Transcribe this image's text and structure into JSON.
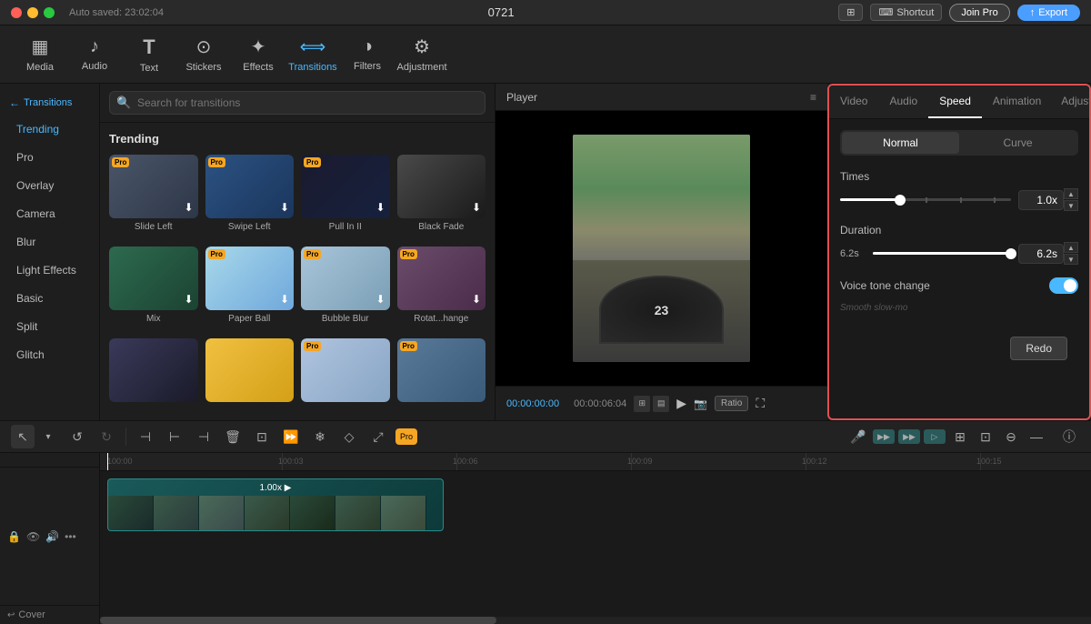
{
  "app": {
    "title": "0721",
    "auto_saved": "Auto saved: 23:02:04"
  },
  "topbar": {
    "shortcut_label": "Shortcut",
    "join_pro_label": "Join Pro",
    "export_label": "Export",
    "display_icon": "⊞"
  },
  "toolbar": {
    "items": [
      {
        "id": "media",
        "label": "Media",
        "icon": "▦"
      },
      {
        "id": "audio",
        "label": "Audio",
        "icon": "♪"
      },
      {
        "id": "text",
        "label": "Text",
        "icon": "T"
      },
      {
        "id": "stickers",
        "label": "Stickers",
        "icon": "⊙"
      },
      {
        "id": "effects",
        "label": "Effects",
        "icon": "✦"
      },
      {
        "id": "transitions",
        "label": "Transitions",
        "icon": "⟺",
        "active": true
      },
      {
        "id": "filters",
        "label": "Filters",
        "icon": "◑"
      },
      {
        "id": "adjustment",
        "label": "Adjustment",
        "icon": "⚙"
      }
    ]
  },
  "sidebar": {
    "back_label": "← Transitions",
    "items": [
      {
        "id": "trending",
        "label": "Trending",
        "active": true
      },
      {
        "id": "pro",
        "label": "Pro"
      },
      {
        "id": "overlay",
        "label": "Overlay"
      },
      {
        "id": "camera",
        "label": "Camera"
      },
      {
        "id": "blur",
        "label": "Blur"
      },
      {
        "id": "light_effects",
        "label": "Light Effects"
      },
      {
        "id": "basic",
        "label": "Basic"
      },
      {
        "id": "split",
        "label": "Split"
      },
      {
        "id": "glitch",
        "label": "Glitch"
      }
    ]
  },
  "search": {
    "placeholder": "Search for transitions"
  },
  "transitions": {
    "section_title": "Trending",
    "items": [
      {
        "id": "slide_left",
        "label": "Slide Left",
        "pro": true,
        "downloadable": true,
        "style": "thumb-slide-left"
      },
      {
        "id": "swipe_left",
        "label": "Swipe Left",
        "pro": true,
        "downloadable": true,
        "style": "thumb-swipe-left"
      },
      {
        "id": "pull_in",
        "label": "Pull In II",
        "pro": true,
        "downloadable": true,
        "style": "thumb-pull-in"
      },
      {
        "id": "black_fade",
        "label": "Black Fade",
        "pro": false,
        "downloadable": true,
        "style": "thumb-black-fade"
      },
      {
        "id": "mix",
        "label": "Mix",
        "pro": false,
        "downloadable": true,
        "style": "thumb-mix"
      },
      {
        "id": "paper_ball",
        "label": "Paper Ball",
        "pro": true,
        "downloadable": true,
        "style": "thumb-paper-ball"
      },
      {
        "id": "bubble_blur",
        "label": "Bubble Blur",
        "pro": true,
        "downloadable": true,
        "style": "thumb-bubble-blur"
      },
      {
        "id": "rotate_change",
        "label": "Rotat...hange",
        "pro": true,
        "downloadable": true,
        "style": "thumb-rotate"
      },
      {
        "id": "row3a",
        "label": "",
        "pro": false,
        "downloadable": false,
        "style": "thumb-row3a"
      },
      {
        "id": "row3b",
        "label": "",
        "pro": false,
        "downloadable": false,
        "style": "thumb-row3b"
      },
      {
        "id": "row3c",
        "label": "",
        "pro": true,
        "downloadable": false,
        "style": "thumb-row3c"
      },
      {
        "id": "row3d",
        "label": "",
        "pro": true,
        "downloadable": false,
        "style": "thumb-row3d"
      }
    ]
  },
  "player": {
    "title": "Player",
    "time_current": "00:00:00:00",
    "time_total": "00:00:06:04"
  },
  "right_panel": {
    "tabs": [
      {
        "id": "video",
        "label": "Video"
      },
      {
        "id": "audio",
        "label": "Audio"
      },
      {
        "id": "speed",
        "label": "Speed",
        "active": true
      },
      {
        "id": "animation",
        "label": "Animation"
      },
      {
        "id": "adjustment",
        "label": "Adjustment>>"
      }
    ],
    "speed": {
      "mode_normal": "Normal",
      "mode_curve": "Curve",
      "times_label": "Times",
      "times_value": "1.0x",
      "duration_label": "Duration",
      "duration_left": "6.2s",
      "duration_right": "6.2s",
      "voice_tone_label": "Voice tone change",
      "smooth_hint": "Smooth slow-mo",
      "redo_label": "Redo"
    }
  },
  "timeline": {
    "time_marks": [
      "100:00",
      "100:03",
      "100:06",
      "100:09",
      "100:12",
      "100:15"
    ],
    "clip_label": "1.00x ▶",
    "cover_label": "Cover"
  }
}
